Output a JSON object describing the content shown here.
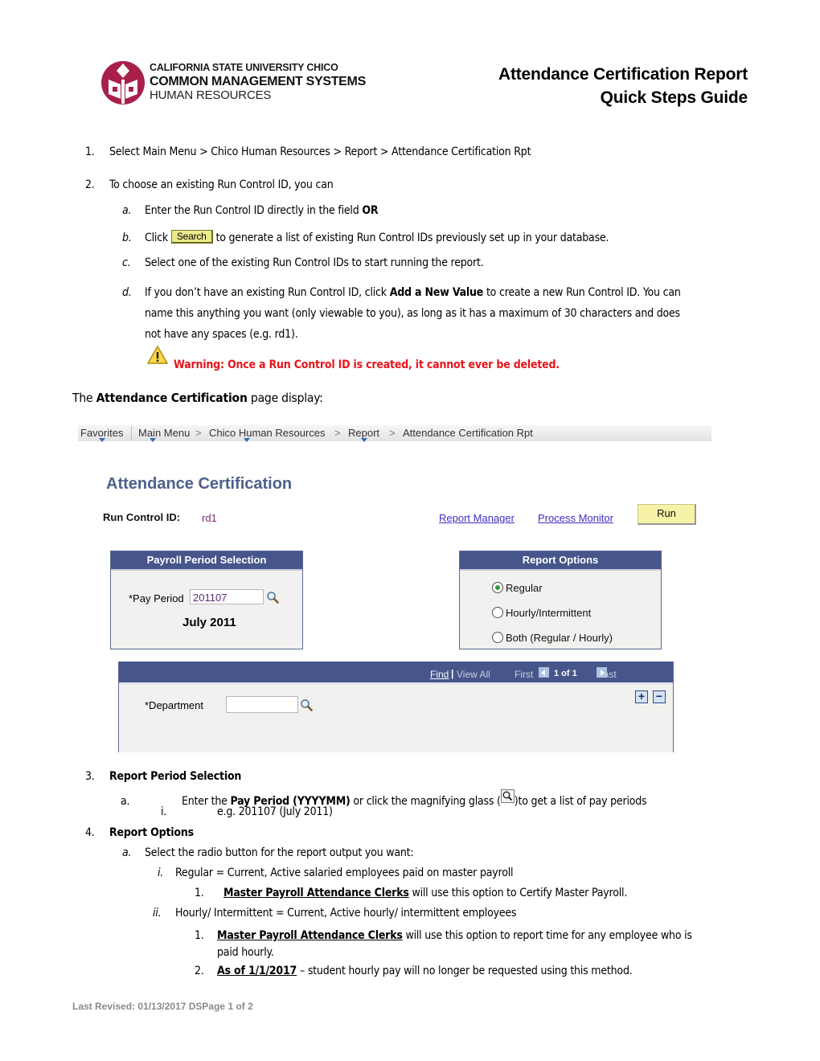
{
  "header": {
    "logo": {
      "line1": "CALIFORNIA STATE UNIVERSITY CHICO",
      "line2": "COMMON MANAGEMENT SYSTEMS",
      "line3": "HUMAN RESOURCES",
      "brand_color": "#a8204a"
    },
    "title_line1": "Attendance Certification Report",
    "title_line2": "Quick Steps Guide"
  },
  "steps": {
    "s1": {
      "num": "1.",
      "text": "Select  Main Menu > Chico Human Resources > Report > Attendance Certification Rpt"
    },
    "s2": {
      "num": "2.",
      "text": "To choose an existing Run Control ID, you can",
      "a": {
        "label": "a.",
        "text": "Enter the Run Control ID directly in the field ",
        "bold": "OR"
      },
      "b": {
        "label": "b.",
        "pre": "Click ",
        "button": "Search",
        "post": " to generate a list of existing Run Control IDs previously set up in your database."
      },
      "c": {
        "label": "c.",
        "text": "Select one of the existing Run Control IDs to start running the report."
      },
      "d": {
        "label": "d.",
        "pre": "If you don’t have an existing Run Control ID, click ",
        "bold": "Add a New Value",
        "line1_post": " to create a new Run Control ID. You can",
        "line2": "name this anything you want (only viewable to you), as long as it has a maximum of 30 characters and does",
        "line3": "not have any spaces (e.g. rd1)."
      },
      "warning": "Warning: Once a Run Control ID is created, it cannot ever be deleted."
    },
    "intro": {
      "pre": "The ",
      "bold": "Attendance Certification",
      "post": " page display:"
    },
    "s3": {
      "num": "3.",
      "title": "Report Period Selection",
      "a": {
        "label": "a.",
        "pre": "Enter the ",
        "bold": "Pay Period (YYYYMM)",
        "mid": " or click the magnifying glass (",
        "post": ")to get a list of pay periods"
      },
      "i": {
        "label": "i.",
        "text": "e.g. 201107 (July 2011)"
      }
    },
    "s4": {
      "num": "4.",
      "title": "Report Options",
      "a": {
        "label": "a.",
        "text": "Select the radio button for the report output you want:"
      },
      "i": {
        "label": "i.",
        "text": "Regular = Current, Active salaried employees paid on master payroll",
        "n1": {
          "num": "1.",
          "u": "Master Payroll Attendance Clerks",
          "text": " will use this option to Certify Master Payroll."
        }
      },
      "ii": {
        "label": "ii.",
        "text": "Hourly/ Intermittent = Current, Active hourly/ intermittent employees",
        "n1": {
          "num": "1.",
          "u": "Master Payroll Attendance Clerks",
          "text": " will use this option to report time for any employee who is",
          "text2": "paid hourly."
        },
        "n2": {
          "num": "2.",
          "u": "As of 1/1/2017",
          "text": " – student hourly pay will no longer be requested using this method."
        }
      }
    }
  },
  "screenshot": {
    "breadcrumbs": [
      "Favorites",
      "Main Menu",
      "Chico Human Resources",
      "Report",
      "Attendance Certification Rpt"
    ],
    "separator": ">",
    "page_title": "Attendance Certification",
    "run_control_label": "Run Control ID:",
    "run_control_value": "rd1",
    "report_manager": "Report Manager",
    "process_monitor": "Process Monitor",
    "run_button": "Run",
    "payroll_group": {
      "title": "Payroll Period Selection",
      "pay_period_label": "*Pay Period",
      "pay_period_value": "201107",
      "pay_period_desc": "July 2011"
    },
    "report_options": {
      "title": "Report Options",
      "options": [
        {
          "label": "Regular",
          "selected": true
        },
        {
          "label": "Hourly/Intermittent",
          "selected": false
        },
        {
          "label": "Both (Regular / Hourly)",
          "selected": false
        }
      ]
    },
    "dept_grid": {
      "find": "Find",
      "sep": "|",
      "view_all": "View All",
      "first": "First",
      "page_count": "1 of 1",
      "last": "Last",
      "department_label": "*Department",
      "department_value": "",
      "add_row": "+",
      "delete_row": "−"
    },
    "header_color": "#47568a"
  },
  "footer": "Last Revised: 01/13/2017 DSPage 1 of 2"
}
